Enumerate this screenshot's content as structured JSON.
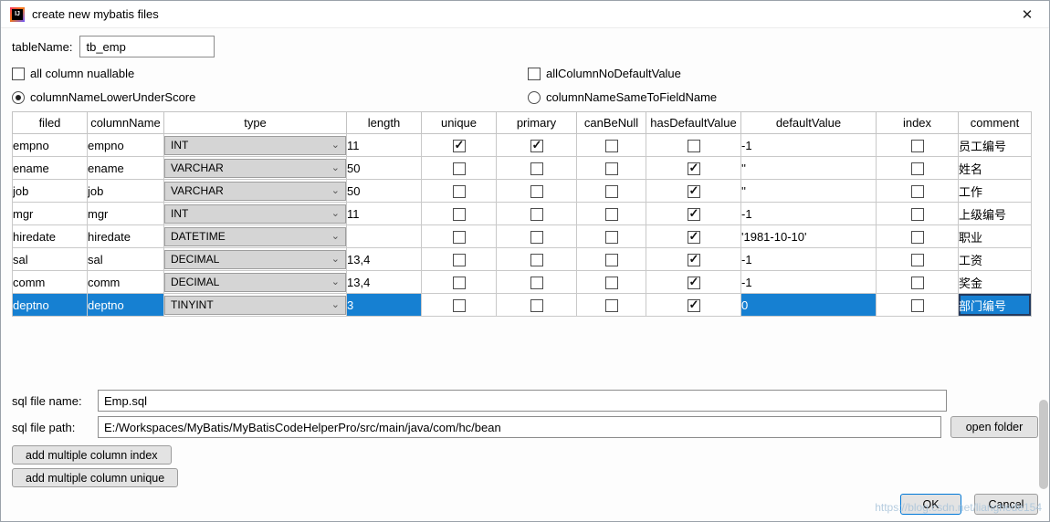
{
  "colors": {
    "selection_blue": "#1680d2",
    "accent_blue": "#0078d7"
  },
  "icons": {
    "chevron_down": "⌄",
    "check": "✓",
    "close": "✕"
  },
  "window": {
    "title": "create new mybatis files"
  },
  "form": {
    "table_name": {
      "label": "tableName:",
      "value": "tb_emp"
    },
    "options": {
      "all_column_nullable": {
        "label": "all column nuallable",
        "checked": false
      },
      "all_column_no_default": {
        "label": "allColumnNoDefaultValue",
        "checked": false
      },
      "lower_underscore": {
        "label": "columnNameLowerUnderScore",
        "selected": true
      },
      "same_to_field": {
        "label": "columnNameSameToFieldName",
        "selected": false
      }
    }
  },
  "table": {
    "headers": [
      "filed",
      "columnName",
      "type",
      "length",
      "unique",
      "primary",
      "canBeNull",
      "hasDefaultValue",
      "defaultValue",
      "index",
      "comment"
    ],
    "rows": [
      {
        "filed": "empno",
        "columnName": "empno",
        "type": "INT",
        "length": "11",
        "unique": true,
        "primary": true,
        "canBeNull": false,
        "hasDefaultValue": false,
        "defaultValue": "-1",
        "index": false,
        "comment": "员工编号",
        "selected": false
      },
      {
        "filed": "ename",
        "columnName": "ename",
        "type": "VARCHAR",
        "length": "50",
        "unique": false,
        "primary": false,
        "canBeNull": false,
        "hasDefaultValue": true,
        "defaultValue": "''",
        "index": false,
        "comment": "姓名",
        "selected": false
      },
      {
        "filed": "job",
        "columnName": "job",
        "type": "VARCHAR",
        "length": "50",
        "unique": false,
        "primary": false,
        "canBeNull": false,
        "hasDefaultValue": true,
        "defaultValue": "''",
        "index": false,
        "comment": "工作",
        "selected": false
      },
      {
        "filed": "mgr",
        "columnName": "mgr",
        "type": "INT",
        "length": "11",
        "unique": false,
        "primary": false,
        "canBeNull": false,
        "hasDefaultValue": true,
        "defaultValue": "-1",
        "index": false,
        "comment": "上级编号",
        "selected": false
      },
      {
        "filed": "hiredate",
        "columnName": "hiredate",
        "type": "DATETIME",
        "length": "",
        "unique": false,
        "primary": false,
        "canBeNull": false,
        "hasDefaultValue": true,
        "defaultValue": "'1981-10-10'",
        "index": false,
        "comment": "职业",
        "selected": false
      },
      {
        "filed": "sal",
        "columnName": "sal",
        "type": "DECIMAL",
        "length": "13,4",
        "unique": false,
        "primary": false,
        "canBeNull": false,
        "hasDefaultValue": true,
        "defaultValue": "-1",
        "index": false,
        "comment": "工资",
        "selected": false
      },
      {
        "filed": "comm",
        "columnName": "comm",
        "type": "DECIMAL",
        "length": "13,4",
        "unique": false,
        "primary": false,
        "canBeNull": false,
        "hasDefaultValue": true,
        "defaultValue": "-1",
        "index": false,
        "comment": "奖金",
        "selected": false
      },
      {
        "filed": "deptno",
        "columnName": "deptno",
        "type": "TINYINT",
        "length": "3",
        "unique": false,
        "primary": false,
        "canBeNull": false,
        "hasDefaultValue": true,
        "defaultValue": "0",
        "index": false,
        "comment": "部门编号",
        "selected": true
      }
    ]
  },
  "files": {
    "name": {
      "label": "sql file name:",
      "value": "Emp.sql"
    },
    "path": {
      "label": "sql file path:",
      "value": "E:/Workspaces/MyBatis/MyBatisCodeHelperPro/src/main/java/com/hc/bean"
    },
    "open_folder": "open folder"
  },
  "actions": {
    "add_index": "add multiple column index",
    "add_unique": "add multiple column unique",
    "ok": "OK",
    "cancel": "Cancel"
  },
  "watermark": "https://blog.csdn.net/lianghede154"
}
